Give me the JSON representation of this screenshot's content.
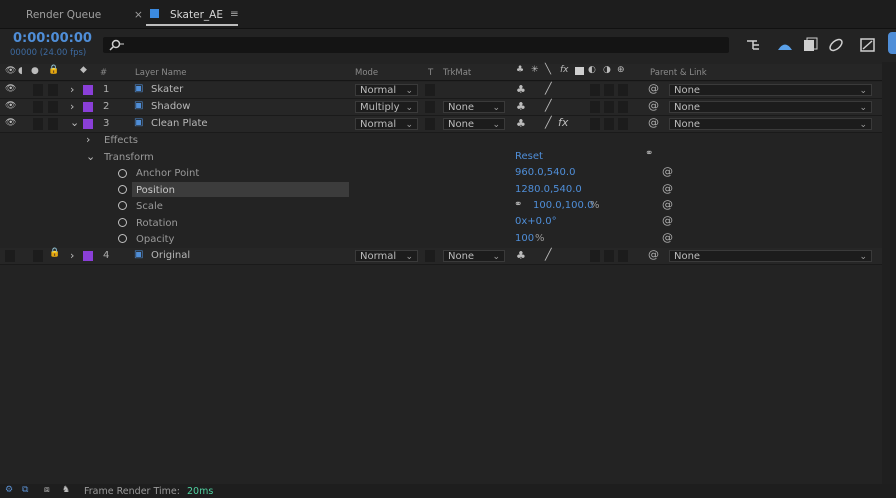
{
  "tabs": [
    {
      "label": "Render Queue"
    },
    {
      "close": "×",
      "label": "Skater_AE",
      "menu": "≡"
    }
  ],
  "timeline": {
    "timecode": "0:00:00:00",
    "fps": "00000 (24.00 fps)",
    "search_icon": "search-icon"
  },
  "columns": {
    "hash": "#",
    "layer_name": "Layer Name",
    "mode": "Mode",
    "t": "T",
    "trkmat": "TrkMat",
    "parent": "Parent & Link"
  },
  "layers": [
    {
      "num": "1",
      "name": "Skater",
      "mode": "Normal",
      "trkmat": "",
      "parent": "None",
      "label_color": "#8a3fd8"
    },
    {
      "num": "2",
      "name": "Shadow",
      "mode": "Multiply",
      "trkmat": "None",
      "parent": "None",
      "label_color": "#8a3fd8"
    },
    {
      "num": "3",
      "name": "Clean Plate",
      "mode": "Normal",
      "trkmat": "None",
      "parent": "None",
      "fx": "fx",
      "label_color": "#8a3fd8"
    },
    {
      "num": "4",
      "name": "Original",
      "mode": "Normal",
      "trkmat": "None",
      "parent": "None",
      "label_color": "#8a3fd8"
    }
  ],
  "groups": {
    "effects": "Effects",
    "transform": "Transform",
    "reset": "Reset"
  },
  "properties": [
    {
      "name": "Anchor Point",
      "value": "960.0,540.0"
    },
    {
      "name": "Position",
      "value": "1280.0,540.0"
    },
    {
      "name": "Scale",
      "value": "100.0,100.0",
      "unit": "%"
    },
    {
      "name": "Rotation",
      "value": "0x+0.0°"
    },
    {
      "name": "Opacity",
      "value": "100",
      "unit": "%"
    }
  ],
  "footer": {
    "label": "Frame Render Time:",
    "value": "20ms"
  },
  "colors": {
    "accent_blue": "#4f8ed8",
    "label_purple": "#8a3fd8",
    "footer_value": "#4fd0a0"
  }
}
